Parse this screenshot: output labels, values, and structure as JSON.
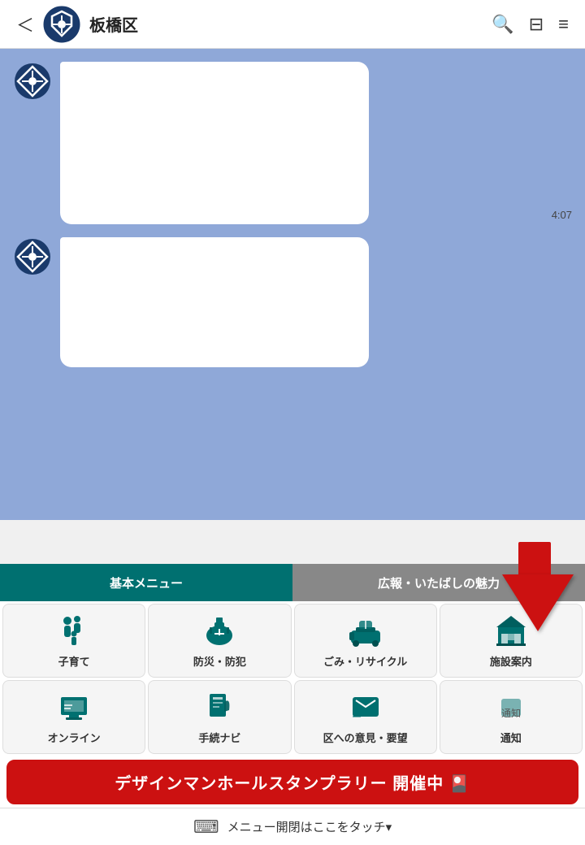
{
  "header": {
    "back_label": "＜",
    "title": "板橋区",
    "search_icon": "🔍",
    "list_icon": "⊟",
    "menu_icon": "≡"
  },
  "chat": {
    "messages": [
      {
        "time": "4:07",
        "bubble_count": 2
      }
    ]
  },
  "tabs": [
    {
      "label": "基本メニュー",
      "active": true
    },
    {
      "label": "広報・いたばしの魅力",
      "active": false
    }
  ],
  "menu_items": [
    {
      "icon": "👨‍👩‍👧",
      "label": "子育て"
    },
    {
      "icon": "⛑",
      "label": "防災・防犯"
    },
    {
      "icon": "🚛",
      "label": "ごみ・リサイクル"
    },
    {
      "icon": "🏛",
      "label": "施設案内"
    },
    {
      "icon": "💻",
      "label": "オンライン"
    },
    {
      "icon": "📄",
      "label": "手続ナビ"
    },
    {
      "icon": "✉",
      "label": "区への意見・要望"
    },
    {
      "icon": "🔔",
      "label": "通知"
    }
  ],
  "banner": {
    "text": "デザインマンホールスタンプラリー 開催中 🎴"
  },
  "footer": {
    "keyboard_icon": "⌨",
    "text": "メニュー開閉はここをタッチ▾"
  }
}
